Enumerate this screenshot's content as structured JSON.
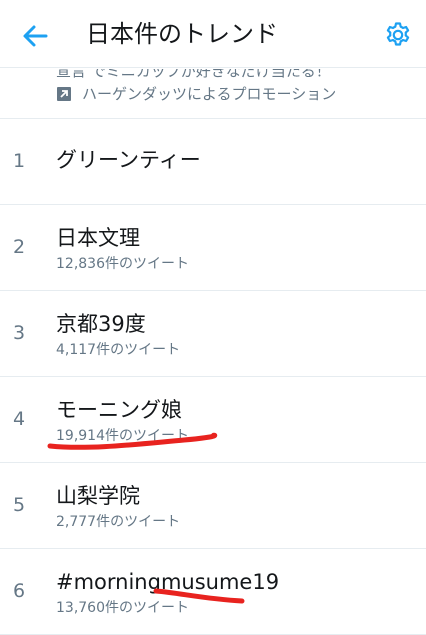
{
  "header": {
    "title": "日本件のトレンド",
    "accent_color": "#1da1f2",
    "back_icon": "arrow-left-icon",
    "settings_icon": "gear-icon"
  },
  "promo": {
    "cut_off_text": "宣言 でミニカップが好きなだけ当たる！",
    "promoted_label": "ハーゲンダッツによるプロモーション",
    "icon": "promoted-icon"
  },
  "trends": [
    {
      "rank": "1",
      "name": "グリーンティー",
      "count": ""
    },
    {
      "rank": "2",
      "name": "日本文理",
      "count": "12,836件のツイート"
    },
    {
      "rank": "3",
      "name": "京都39度",
      "count": "4,117件のツイート"
    },
    {
      "rank": "4",
      "name": "モーニング娘",
      "count": "19,914件のツイート"
    },
    {
      "rank": "5",
      "name": "山梨学院",
      "count": "2,777件のツイート"
    },
    {
      "rank": "6",
      "name": "#morningmusume19",
      "count": "13,760件のツイート"
    }
  ],
  "annotation_color": "#e8231f"
}
